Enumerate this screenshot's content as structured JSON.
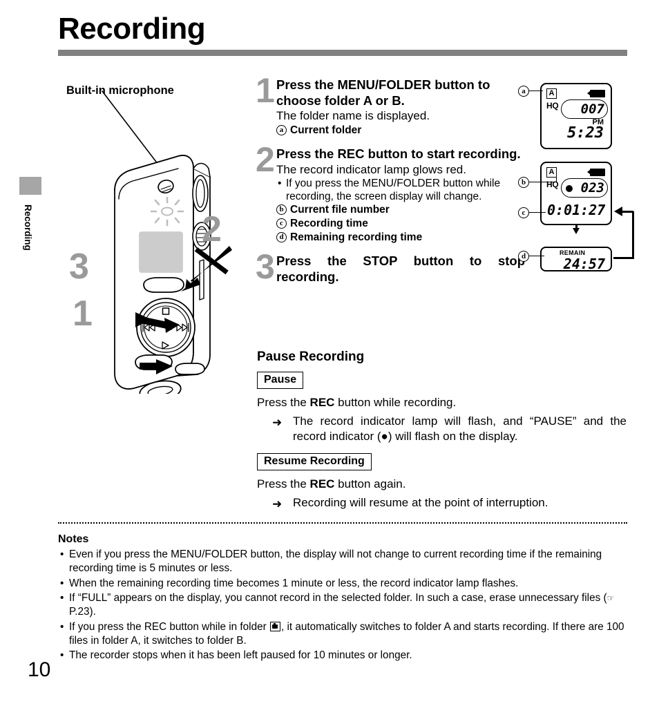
{
  "page": {
    "title": "Recording",
    "number": "10",
    "side_tab_label": "Recording"
  },
  "illustration": {
    "mic_label": "Built-in microphone",
    "callout_numbers": [
      "1",
      "2",
      "3"
    ],
    "stop_icon": "stop-square-icon",
    "prev_icon": "rewind-icon",
    "next_icon": "fast-forward-icon",
    "play_icon": "play-icon"
  },
  "steps": [
    {
      "num": "1",
      "title": "Press the MENU/FOLDER button to choose folder A or B.",
      "title_pre": "Press the ",
      "title_bold": "MENU/FOLDER",
      "title_post": " button to choose folder A or B.",
      "sub": "The folder name is displayed.",
      "legend": [
        {
          "mark": "a",
          "text": "Current folder"
        }
      ]
    },
    {
      "num": "2",
      "title_pre": "Press the ",
      "title_bold": "REC",
      "title_post": " button to start recording.",
      "sub": "The record indicator lamp glows red.",
      "bullet": "If you press the MENU/FOLDER button while recording, the screen display will change.",
      "legend": [
        {
          "mark": "b",
          "text": "Current file number"
        },
        {
          "mark": "c",
          "text": "Recording time"
        },
        {
          "mark": "d",
          "text": "Remaining recording time"
        }
      ]
    },
    {
      "num": "3",
      "title_pre": "Press the ",
      "title_bold": "STOP",
      "title_post": " button to stop recording.",
      "sub": "",
      "legend": []
    }
  ],
  "pause_section": {
    "heading": "Pause Recording",
    "pause_label": "Pause",
    "pause_text_pre": "Press the ",
    "pause_text_bold": "REC",
    "pause_text_post": " button while recording.",
    "pause_arrow": "➜",
    "pause_result": "The record indicator lamp will flash, and “PAUSE” and the record indicator (●) will flash on the display.",
    "resume_label": "Resume Recording",
    "resume_text_pre": "Press the ",
    "resume_text_bold": "REC",
    "resume_text_post": " button again.",
    "resume_arrow": "➜",
    "resume_result": "Recording will resume at the point of interruption."
  },
  "lcd_panels": [
    {
      "id": "lcd-1",
      "folder": "A",
      "quality": "HQ",
      "file_number": "007",
      "am_pm": "PM",
      "clock": "5:23",
      "battery": "battery-full-icon"
    },
    {
      "id": "lcd-2",
      "folder": "A",
      "quality": "HQ",
      "file_number": "023",
      "rec_indicator": "record-dot-icon",
      "recording_time": "0:01:27",
      "battery": "battery-full-icon"
    },
    {
      "id": "lcd-3",
      "remain_label": "REMAIN",
      "remain_value": "24:57"
    }
  ],
  "callouts": [
    {
      "mark": "a"
    },
    {
      "mark": "b"
    },
    {
      "mark": "c"
    },
    {
      "mark": "d"
    }
  ],
  "notes": {
    "heading": "Notes",
    "items": [
      "Even if you press the MENU/FOLDER button, the display will not change to current recording time if the remaining recording time is 5 minutes or less.",
      "When the remaining recording time becomes 1 minute or less, the record indicator lamp flashes.",
      "The recorder stops when it has been left paused for 10 minutes or longer."
    ],
    "note_full_pre": "If “FULL” appears on the display, you cannot record in the selected folder. In such a case, erase unnecessary files (",
    "note_full_ref": " P.23).",
    "note_full_icon": "pointing-hand-icon",
    "note_folder_pre": "If you press the REC button while in folder ",
    "note_folder_post": ", it automatically switches to folder A and starts recording. If there are 100 files in folder A, it switches to folder B.",
    "note_folder_icon": "folder-camera-icon"
  },
  "colors": {
    "rule": "#808080",
    "step_number": "#9a9a9a",
    "tab": "#a6a6a6"
  }
}
